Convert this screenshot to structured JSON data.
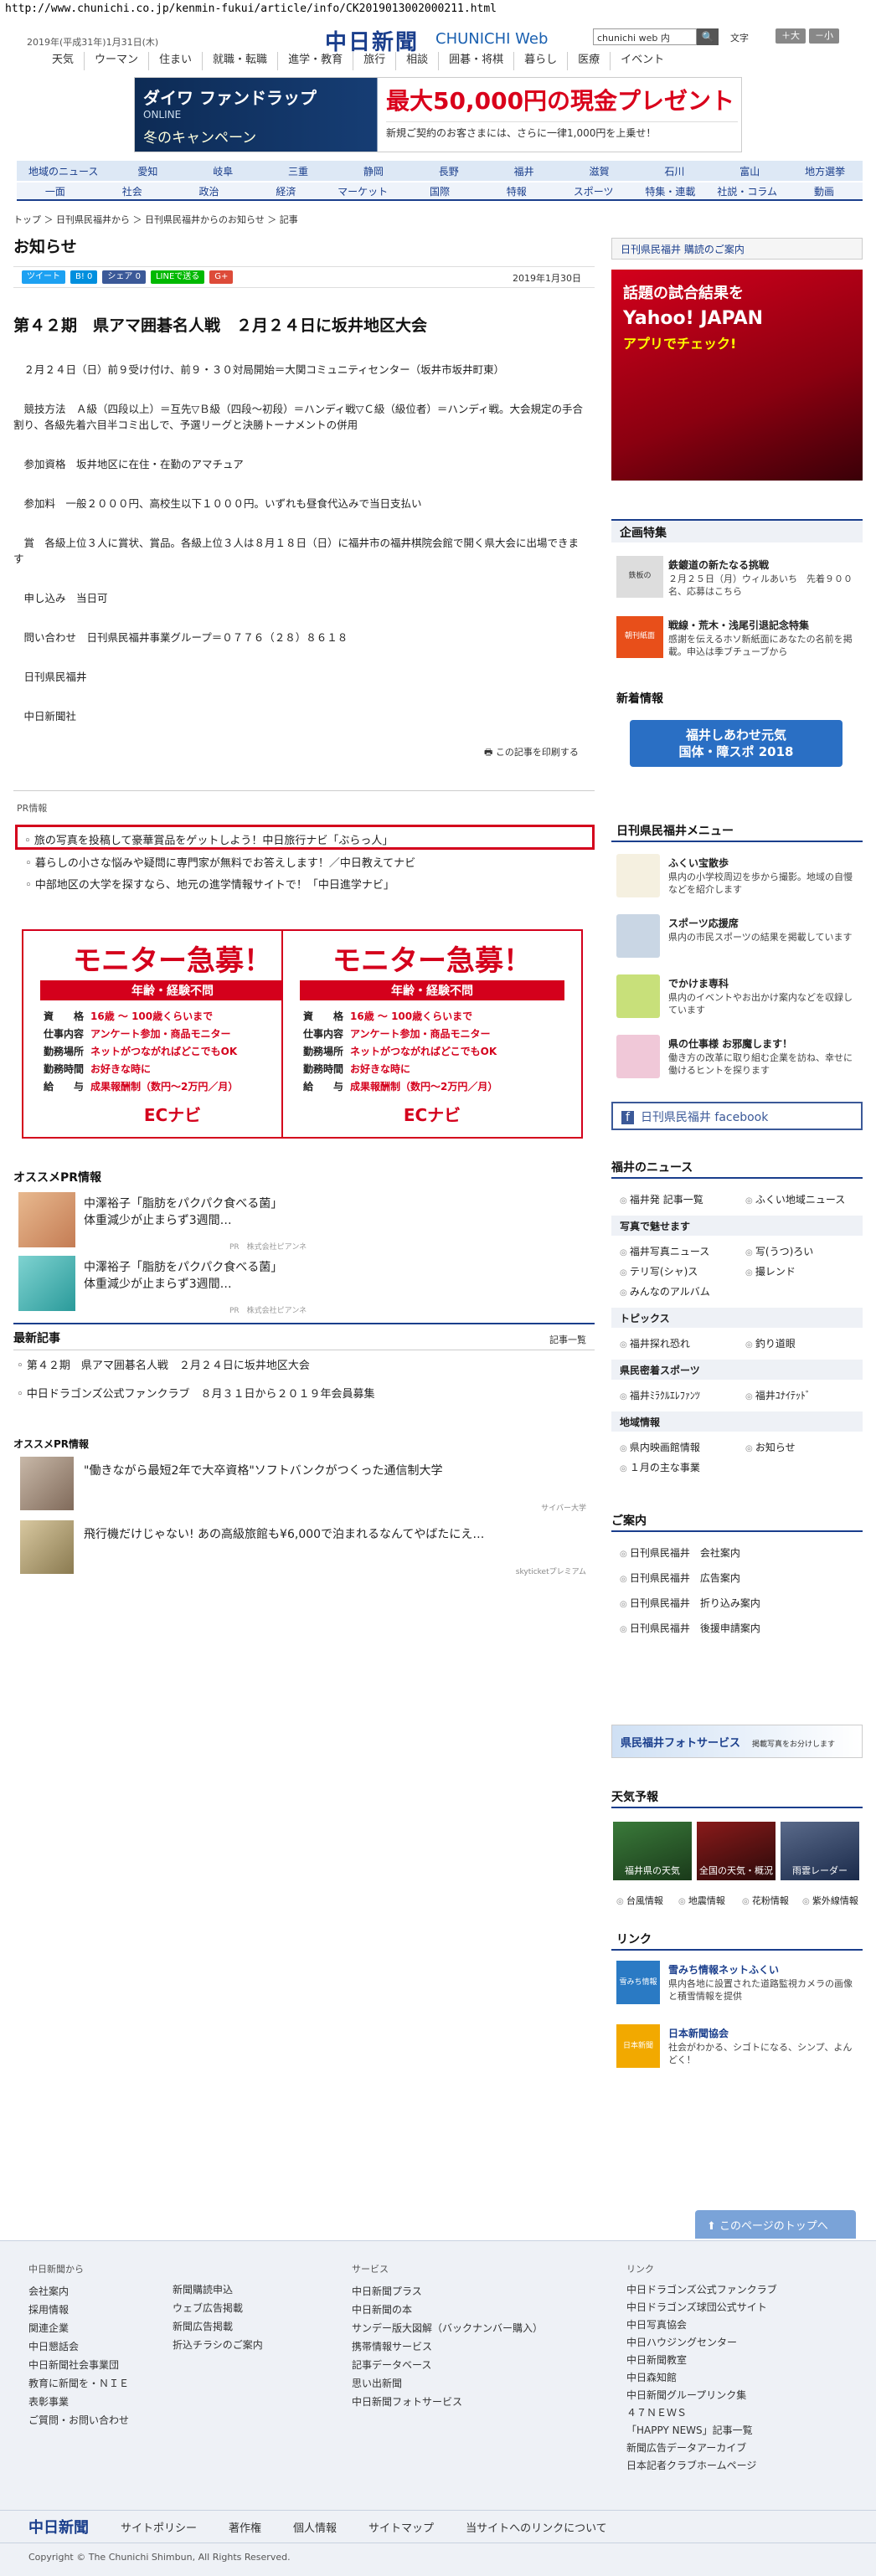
{
  "url": "http://www.chunichi.co.jp/kenmin-fukui/article/info/CK2019013002000211.html",
  "header": {
    "date": "2019年(平成31年)1月31日(木)",
    "logo": "中日新聞",
    "logo_sub": "CHUNICHI Web",
    "search_placeholder": "chunichi web 内",
    "search_button": "🔍",
    "fontsize_label": "文字",
    "font_large": "＋大",
    "font_small": "－小",
    "gnav": [
      "天気",
      "ウーマン",
      "住まい",
      "就職・転職",
      "進学・教育",
      "旅行",
      "相談",
      "囲碁・将棋",
      "暮らし",
      "医療",
      "イベント"
    ]
  },
  "top_ad": {
    "left_line1": "ダイワ ファンドラップ",
    "left_line2": "ONLINE",
    "left_line3": "冬のキャンペーン",
    "right_line1": "最大50,000円の現金プレゼント",
    "right_line2": "新規ご契約のお客さまには、さらに一律1,000円を上乗せ！"
  },
  "region_nav": [
    "地域のニュース",
    "愛知",
    "岐阜",
    "三重",
    "静岡",
    "長野",
    "福井",
    "滋賀",
    "石川",
    "富山",
    "地方選挙"
  ],
  "category_nav": [
    "一面",
    "社会",
    "政治",
    "経済",
    "マーケット",
    "国際",
    "特報",
    "スポーツ",
    "特集・連載",
    "社説・コラム",
    "動画"
  ],
  "breadcrumb": "トップ ＞ 日刊県民福井から ＞ 日刊県民福井からのお知らせ ＞ 記事",
  "page_title": "お知らせ",
  "share": {
    "tweet": "ツイート",
    "b": "B! 0",
    "fb": "シェア 0",
    "line": "LINEで送る",
    "g": "G+"
  },
  "pub_date": "2019年1月30日",
  "article": {
    "title": "第４２期　県アマ囲碁名人戦　２月２４日に坂井地区大会",
    "paragraphs": [
      "２月２４日（日）前９受け付け、前９・３０対局開始＝大関コミュニティセンター（坂井市坂井町東）",
      "競技方法　Ａ級（四段以上）＝互先▽Ｂ級（四段～初段）＝ハンディ戦▽Ｃ級（級位者）＝ハンディ戦。大会規定の手合割り、各級先着六目半コミ出しで、予選リーグと決勝トーナメントの併用",
      "参加資格　坂井地区に在住・在勤のアマチュア",
      "参加料　一般２０００円、高校生以下１０００円。いずれも昼食代込みで当日支払い",
      "賞　各級上位３人に賞状、賞品。各級上位３人は８月１８日（日）に福井市の福井棋院会館で開く県大会に出場できます",
      "申し込み　当日可",
      "問い合わせ　日刊県民福井事業グループ＝０７７６（２８）８６１８",
      "日刊県民福井",
      "中日新聞社"
    ],
    "print": "この記事を印刷する"
  },
  "pr": {
    "label": "PR情報",
    "items": [
      "旅の写真を投稿して豪華賞品をゲットしよう！中日旅行ナビ「ぶらっ人」",
      "暮らしの小さな悩みや疑問に専門家が無料でお答えします！／中日教えてナビ",
      "中部地区の大学を探すなら、地元の進学情報サイトで！「中日進学ナビ」"
    ]
  },
  "monitor_ad": {
    "title": "モニター急募！",
    "sub": "年齢・経験不問",
    "rows": [
      {
        "k": "資　　格",
        "v": "16歳 〜 100歳くらいまで"
      },
      {
        "k": "仕事内容",
        "v": "アンケート参加・商品モニター"
      },
      {
        "k": "勤務場所",
        "v": "ネットがつながればどこでもOK"
      },
      {
        "k": "勤務時間",
        "v": "お好きな時に"
      },
      {
        "k": "給　　与",
        "v": "成果報酬制（数円〜2万円／月）"
      }
    ],
    "logo": "ECナビ"
  },
  "osusume": {
    "heading": "オススメPR情報",
    "items": [
      {
        "line1": "中澤裕子「脂肪をパクパク食べる菌」",
        "line2": "体重減少が止まらず3週間…",
        "pr": "PR　株式会社ピアンネ"
      },
      {
        "line1": "中澤裕子「脂肪をパクパク食べる菌」",
        "line2": "体重減少が止まらず3週間…",
        "pr": "PR　株式会社ピアンネ"
      }
    ]
  },
  "latest": {
    "heading": "最新記事",
    "more": "記事一覧",
    "items": [
      "第４２期　県アマ囲碁名人戦　２月２４日に坂井地区大会",
      "中日ドラゴンズ公式ファンクラブ　８月３１日から２０１９年会員募集"
    ]
  },
  "osusume2": {
    "heading": "オススメPR情報",
    "items": [
      {
        "text": "\"働きながら最短2年で大卒資格\"ソフトバンクがつくった通信制大学",
        "src": "サイバー大学"
      },
      {
        "text": "飛行機だけじゃない! あの高級旅館も¥6,000で泊まれるなんてやばたにえ…",
        "src": "skyticketプレミアム"
      }
    ]
  },
  "right": {
    "subscribe": "日刊県民福井 購読のご案内",
    "ad_line1": "話題の試合結果を",
    "ad_line2": "Yahoo! JAPAN",
    "ad_line3": "アプリでチェック!",
    "feature_heading": "企画特集",
    "features": [
      {
        "icon": "鉄板の",
        "t1": "鉄鍍道の新たなる挑戦",
        "t2": "２月２５日（月）ウィルあいち　先着９００名、応募はこちら"
      },
      {
        "icon": "朝刊紙面",
        "t1": "戦線・荒木・浅尾引退記念特集",
        "t2": "感謝を伝えるホソ新紙面にあなたの名前を掲載。申込は季ブチューブから"
      }
    ],
    "shincho_heading": "新着情報",
    "shincho_banner_1": "福井しあわせ元気",
    "shincho_banner_2": "国体・障スポ 2018",
    "menu_heading": "日刊県民福井メニュー",
    "menu": [
      {
        "t1": "ふくい宝散歩",
        "t2": "県内の小学校周辺を歩から撮影。地域の自慢などを紹介します"
      },
      {
        "t1": "スポーツ応援席",
        "t2": "県内の市民スポーツの結果を掲載しています"
      },
      {
        "t1": "でかけま専科",
        "t2": "県内のイベントやお出かけ案内などを収録しています"
      },
      {
        "t1": "県の仕事様 お邪魔します！",
        "t2": "働き方の改革に取り組む企業を訪ね、幸せに働けるヒントを探ります"
      }
    ],
    "facebook": "日刊県民福井 facebook",
    "fukui_news_heading": "福井のニュース",
    "fukui_news_links": [
      "福井発 記事一覧",
      "ふくい地域ニュース"
    ],
    "photo_heading": "写真で魅せます",
    "photo_links": [
      "福井写真ニュース",
      "写(うつ)ろい",
      "テリ写(シャ)ス",
      "撮レンド",
      "みんなのアルバム"
    ],
    "topics_heading": "トピックス",
    "topics_links": [
      "福井探れ恐れ",
      "釣り道眼"
    ],
    "sports_heading": "県民密着スポーツ",
    "sports_links": [
      "福井ﾐﾗｸﾙｴﾚﾌｧﾝﾂ",
      "福井ﾕﾅｲﾃｯﾄﾞ"
    ],
    "region_heading": "地域情報",
    "region_links": [
      "県内映画館情報",
      "お知らせ",
      "１月の主な事業"
    ],
    "guide_heading": "ご案内",
    "guide_links": [
      "日刊県民福井　会社案内",
      "日刊県民福井　広告案内",
      "日刊県民福井　折り込み案内",
      "日刊県民福井　後援申請案内"
    ],
    "photo_service": "県民福井フォトサービス",
    "photo_service_sub": "掲載写真をお分けします",
    "weather_heading": "天気予報",
    "weather_boxes": [
      "福井県の天気",
      "全国の天気・概況",
      "雨雲レーダー"
    ],
    "weather_links": [
      "台風情報",
      "地震情報",
      "花粉情報",
      "紫外線情報"
    ],
    "link_heading": "リンク",
    "links": [
      {
        "icon": "雪みち情報",
        "t1": "雪みち情報ネットふくい",
        "t2": "県内各地に設置された道路監視カメラの画像と積雪情報を提供"
      },
      {
        "icon": "日本新聞",
        "t1": "日本新聞協会",
        "t2": "社会がわかる、シゴトになる、シンプ、よんどく！"
      }
    ]
  },
  "totop": "このページのトップへ",
  "footer": {
    "col1_h": "中日新聞から",
    "col1": [
      "会社案内",
      "採用情報",
      "関連企業",
      "中日懇話会",
      "中日新聞社会事業団",
      "教育に新聞を・ＮＩＥ",
      "表彰事業",
      "ご質問・お問い合わせ"
    ],
    "col2": [
      "新聞購読申込",
      "ウェブ広告掲載",
      "新聞広告掲載",
      "折込チラシのご案内"
    ],
    "col3_h": "サービス",
    "col3": [
      "中日新聞プラス",
      "中日新聞の本",
      "サンデー版大図解（バックナンバー購入）",
      "携帯情報サービス",
      "記事データベース",
      "思い出新聞",
      "中日新聞フォトサービス"
    ],
    "col4_h": "リンク",
    "col4": [
      "中日ドラゴンズ公式ファンクラブ",
      "中日ドラゴンズ球団公式サイト",
      "中日写真協会",
      "中日ハウジングセンター",
      "中日新聞教室",
      "中日森知館",
      "中日新聞グループリンク集",
      "４７ＮＥＷＳ",
      "「HAPPY NEWS」記事一覧",
      "新聞広告データアーカイブ",
      "日本記者クラブホームページ"
    ],
    "bar_logo": "中日新聞",
    "bar": [
      "サイトポリシー",
      "著作権",
      "個人情報",
      "サイトマップ",
      "当サイトへのリンクについて"
    ],
    "copyright": "Copyright © The Chunichi Shimbun, All Rights Reserved."
  }
}
